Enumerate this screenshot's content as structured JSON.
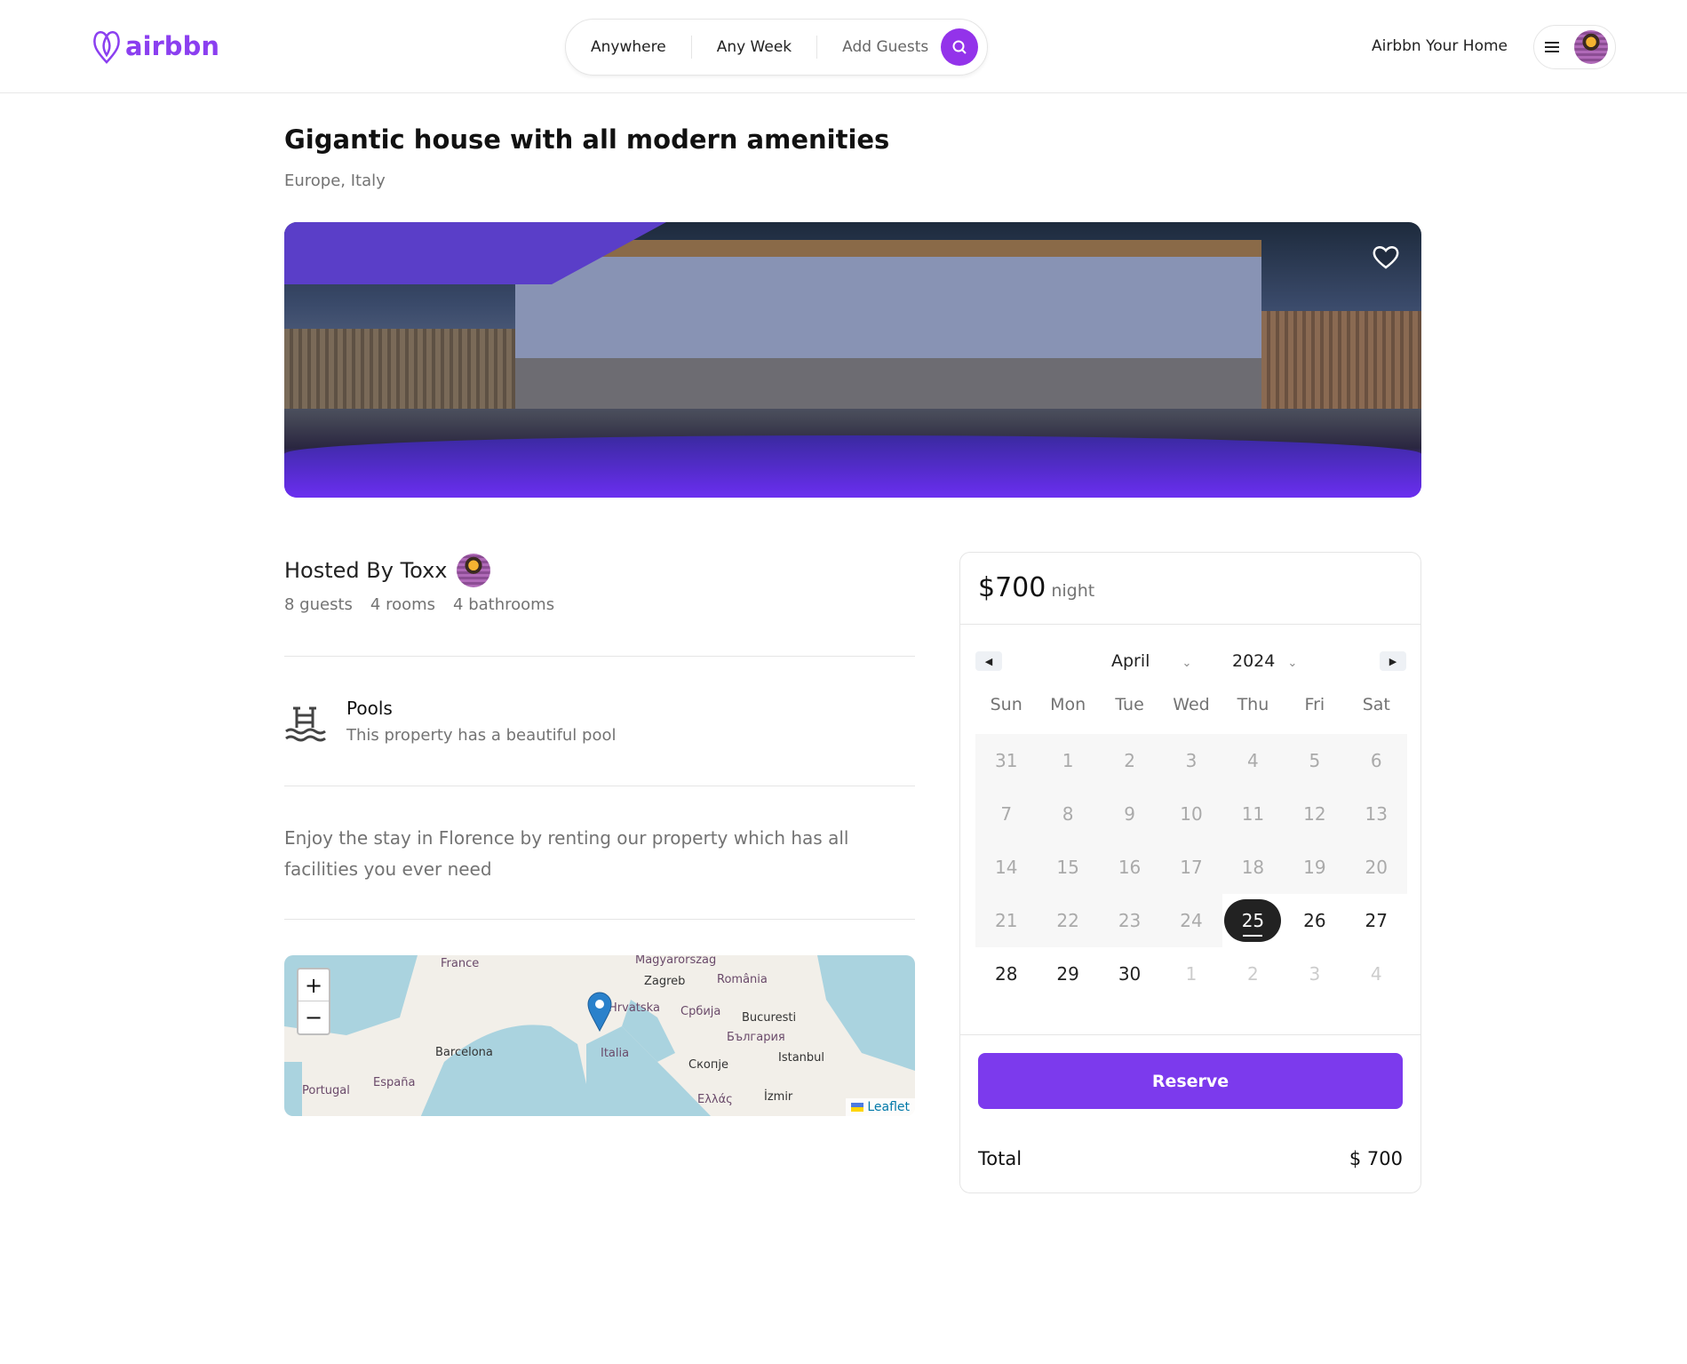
{
  "header": {
    "brand": "airbbn",
    "search": {
      "where": "Anywhere",
      "when": "Any Week",
      "guests": "Add Guests"
    },
    "host_link": "Airbbn Your Home",
    "brand_color": "#8b3ff0"
  },
  "listing": {
    "title": "Gigantic house with all modern amenities",
    "location": "Europe, Italy",
    "host": "Hosted By Toxx",
    "stats": [
      "8 guests",
      "4 rooms",
      "4 bathrooms"
    ],
    "feature": {
      "icon": "pool-icon",
      "title": "Pools",
      "description": "This property has a beautiful pool"
    },
    "description": "Enjoy the stay in Florence by renting our property which has all facilities you ever need"
  },
  "map": {
    "labels": [
      "France",
      "Magyarorszag",
      "Zagreb",
      "România",
      "Hrvatska",
      "Србија",
      "Bucuresti",
      "България",
      "Barcelona",
      "Italia",
      "Скопје",
      "Istanbul",
      "Portugal",
      "España",
      "Ελλάς",
      "İzmir"
    ],
    "zoom_in": "+",
    "zoom_out": "−",
    "attribution": "Leaflet"
  },
  "booking": {
    "price": "$700",
    "unit": "night",
    "month": "April",
    "year": "2024",
    "weekdays": [
      "Sun",
      "Mon",
      "Tue",
      "Wed",
      "Thu",
      "Fri",
      "Sat"
    ],
    "days": [
      "31",
      "1",
      "2",
      "3",
      "4",
      "5",
      "6",
      "7",
      "8",
      "9",
      "10",
      "11",
      "12",
      "13",
      "14",
      "15",
      "16",
      "17",
      "18",
      "19",
      "20",
      "21",
      "22",
      "23",
      "24",
      "25",
      "26",
      "27",
      "28",
      "29",
      "30",
      "1",
      "2",
      "3",
      "4"
    ],
    "selected": "25",
    "reserve": "Reserve",
    "total_label": "Total",
    "total_value": "$ 700",
    "accent": "#7c3aed"
  }
}
